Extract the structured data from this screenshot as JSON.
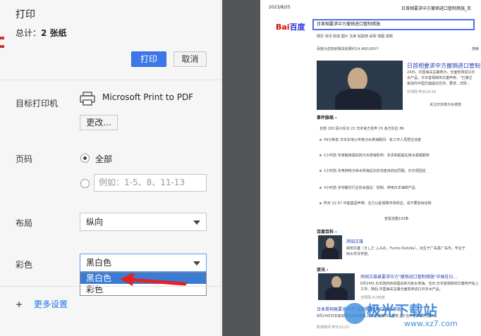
{
  "dialog": {
    "title": "打印",
    "total_prefix": "总计：",
    "total_value": "2 张纸",
    "print_button": "打印",
    "cancel_button": "取消"
  },
  "destination": {
    "label": "目标打印机",
    "printer_name": "Microsoft Print to PDF",
    "change_button": "更改..."
  },
  "pages": {
    "label": "页码",
    "option_all": "全部",
    "custom_placeholder": "例如：1-5、8、11-13"
  },
  "layout": {
    "label": "布局",
    "value": "纵向"
  },
  "color": {
    "label": "彩色",
    "value": "黑白色",
    "options": [
      "黑白色",
      "彩色"
    ]
  },
  "more_settings": "更多设置",
  "preview": {
    "date": "2023/8/25",
    "header": "日首相要求中方撤销进口管制措施_百",
    "logo_a": "Bai",
    "logo_b": "百度",
    "search_text": "日首相要求中方撤销进口管制措施",
    "tabs": "网页  资讯  知道  图片  文库  帖贴吧  采购  地图  视频",
    "result_count": "百度为您找到相关结果约14,490,000个",
    "filter": "搜索",
    "top_title": "日首相要求中方撤销进口管制",
    "top_snip1": "24日，中国海关总署表示，全面暂停进口日",
    "top_snip2": "水产品。日本首相岸田文雄声称，\"已通过",
    "top_snip3": "渠道向中国方面提出交涉，要求...详情 ›",
    "top_src": "环球网  昨天19:34",
    "top_follow": "关注日本核污水排放",
    "timeline": "事件脉络 ›",
    "timeline_tabs": "全部 193    民众反对 22    日本官方发声 15    各方反应 86",
    "events": [
      "59分钟前  日本东电公布核污水排海瞬间：有工作人员捂住浓度",
      "1小时前  专家解读福岛核污水排海影响：负责和船舶在核水或或期待",
      "1小时前  东电称核污染水排海后氚的浓度目前远同题。外交观回应",
      "3小时前  多地餐饮行业协会倡议：抵制、停用日本海鲜产品",
      "昨天 21:57  中盐集团声明：全力以赴保障市场供应，请不要盲目抢购"
    ],
    "view_all": "查看完整193条",
    "baike": "百度百科 ›",
    "baike_name": "岸田文雄",
    "baike_snip1": "岸田文雄（きしだ ふみお，Fumio Kishida），出生于广岛县广岛市，毕业于",
    "baike_snip2": "田大学法学部。",
    "news": "资讯 ›",
    "news_title": "岸田文雄竟要求中方\"撤销进口管制措施\"中国驻日...",
    "news_snip1": "8月24日,日本政府启动福岛核污染水排海。当天,日本首相岸田文雄称开始上",
    "news_snip2": "工作。随后,中国海关总署全面暂停进口日本水产品。",
    "news_src": "光明网  9小时前",
    "news2_title": "日本首相竟要求中方\"立即撤销\"进口大体措施",
    "news2_snip": "8月24日日本启动核污染水排海,日本首相岸田文雄称上午在中环日政府或开",
    "news2_src": "影视新闻  昨天22:22"
  },
  "watermark": {
    "text": "极光下载站",
    "url": "www.xz7.com"
  }
}
